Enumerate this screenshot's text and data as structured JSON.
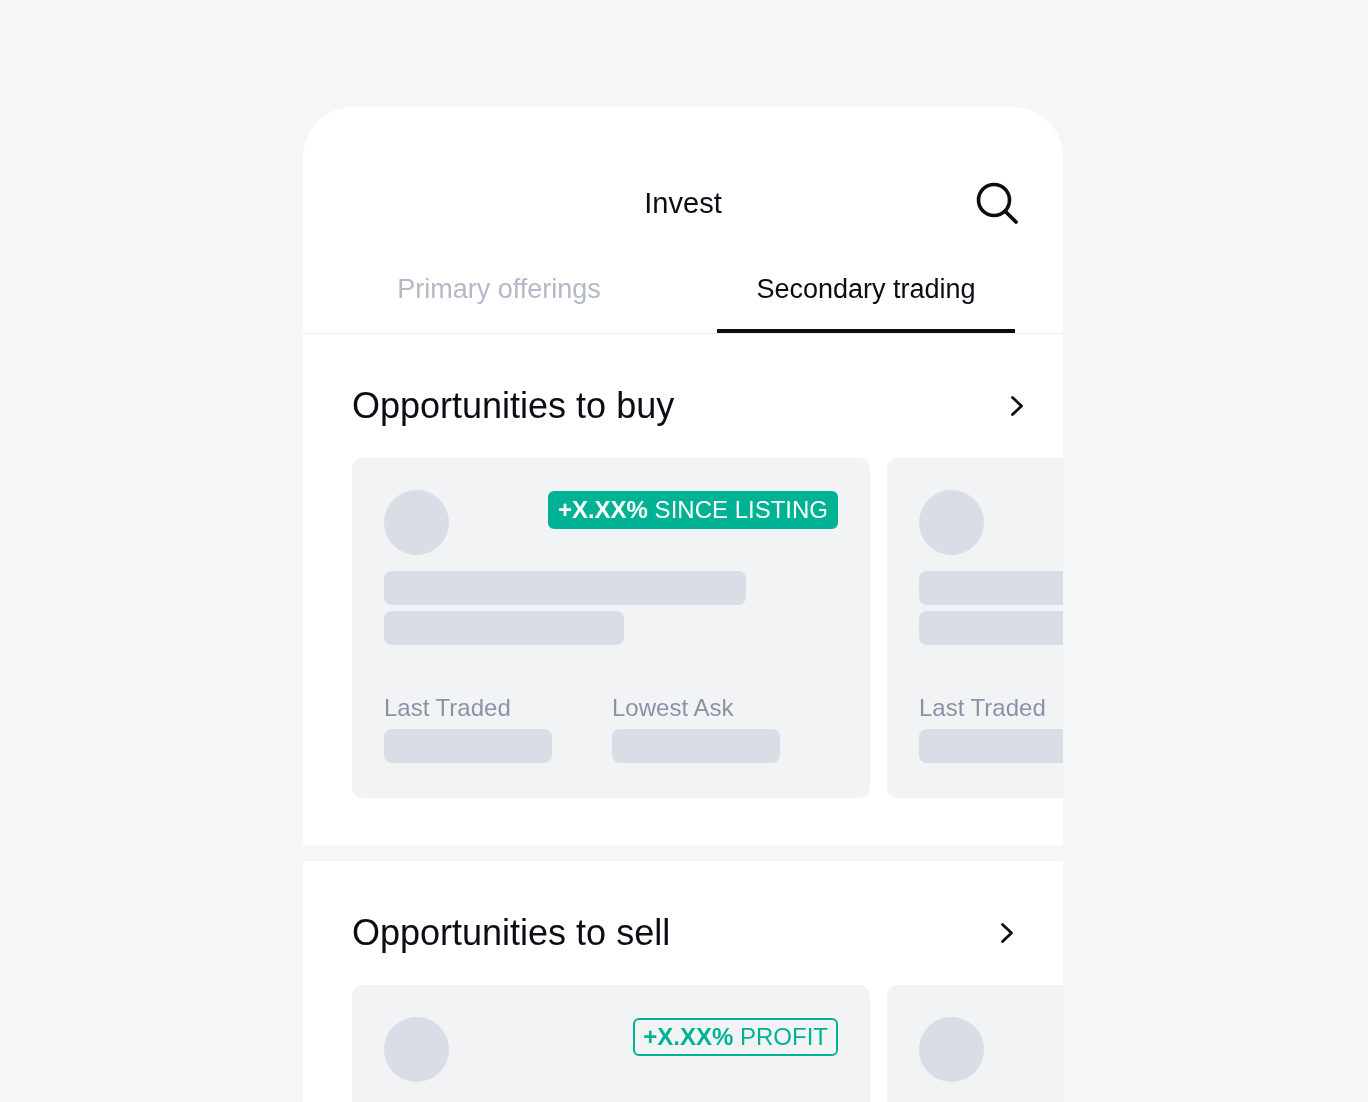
{
  "header": {
    "title": "Invest"
  },
  "tabs": [
    {
      "label": "Primary offerings",
      "selected": false
    },
    {
      "label": "Secondary trading",
      "selected": true
    }
  ],
  "sections": [
    {
      "title": "Opportunities to buy",
      "cards": [
        {
          "kind": "skeleton",
          "badge": {
            "kind": "filled",
            "text": "**+X.XX%** SINCE LISTING"
          },
          "stats": [
            "Last Traded",
            "Lowest Ask"
          ]
        },
        {
          "kind": "skeleton",
          "stats": [
            "Last Traded"
          ]
        }
      ]
    },
    {
      "title": "Opportunities to sell",
      "cards": [
        {
          "kind": "skeleton",
          "badge": {
            "kind": "outline",
            "text": "**+X.XX%** PROFIT"
          }
        },
        {
          "kind": "skeleton"
        }
      ]
    }
  ]
}
